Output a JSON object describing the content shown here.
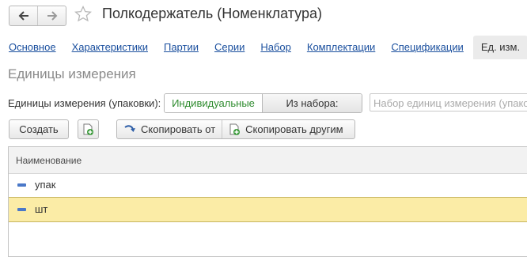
{
  "window": {
    "title": "Полкодержатель (Номенклатура)"
  },
  "nav": {
    "back_icon": "arrow-left-icon",
    "forward_icon": "arrow-right-icon",
    "favorite_icon": "star-icon"
  },
  "tabs": [
    {
      "label": "Основное"
    },
    {
      "label": "Характеристики"
    },
    {
      "label": "Партии"
    },
    {
      "label": "Серии"
    },
    {
      "label": "Набор"
    },
    {
      "label": "Комплектации"
    },
    {
      "label": "Спецификации"
    },
    {
      "label": "Ед. изм.",
      "active": true
    }
  ],
  "section_title": "Единицы измерения",
  "units": {
    "label": "Единицы измерения (упаковки):",
    "options": [
      {
        "label": "Индивидуальные",
        "selected": true
      },
      {
        "label": "Из набора:",
        "selected": false
      }
    ],
    "set_placeholder": "Набор единиц измерения (упаковок)"
  },
  "toolbar": {
    "create_label": "Создать",
    "copy_from_label": "Скопировать от",
    "copy_to_others_label": "Скопировать другим"
  },
  "table": {
    "column_header": "Наименование",
    "rows": [
      {
        "name": "упак",
        "selected": false
      },
      {
        "name": "шт",
        "selected": true
      }
    ]
  },
  "colors": {
    "link": "#1a4f9e",
    "selected_option": "#2e8b2e",
    "selected_row": "#fbeca6",
    "section_title": "#8a8a8a"
  }
}
